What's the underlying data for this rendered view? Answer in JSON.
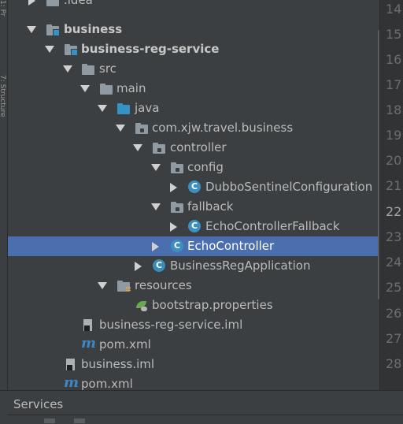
{
  "side_tabs": {
    "top_label": "1: Pr",
    "lower_label": "7: Structure"
  },
  "tree": {
    "rows": [
      {
        "label": ".idea"
      },
      {
        "label": "business"
      },
      {
        "label": "business-reg-service"
      },
      {
        "label": "src"
      },
      {
        "label": "main"
      },
      {
        "label": "java"
      },
      {
        "label": "com.xjw.travel.business"
      },
      {
        "label": "controller"
      },
      {
        "label": "config"
      },
      {
        "label": "DubboSentinelConfiguration"
      },
      {
        "label": "fallback"
      },
      {
        "label": "EchoControllerFallback"
      },
      {
        "label": "EchoController"
      },
      {
        "label": "BusinessRegApplication"
      },
      {
        "label": "resources"
      },
      {
        "label": "bootstrap.properties"
      },
      {
        "label": "business-reg-service.iml"
      },
      {
        "label": "pom.xml"
      },
      {
        "label": "business.iml"
      },
      {
        "label": "pom.xml"
      }
    ]
  },
  "line_numbers": [
    "14",
    "15",
    "16",
    "17",
    "18",
    "19",
    "20",
    "21",
    "22",
    "23",
    "24",
    "25",
    "26",
    "27",
    "28"
  ],
  "bottom": {
    "services_label": "Services"
  },
  "colors": {
    "selection": "#4b6eaf",
    "background": "#3c3f41",
    "source_root": "#3592c4"
  }
}
